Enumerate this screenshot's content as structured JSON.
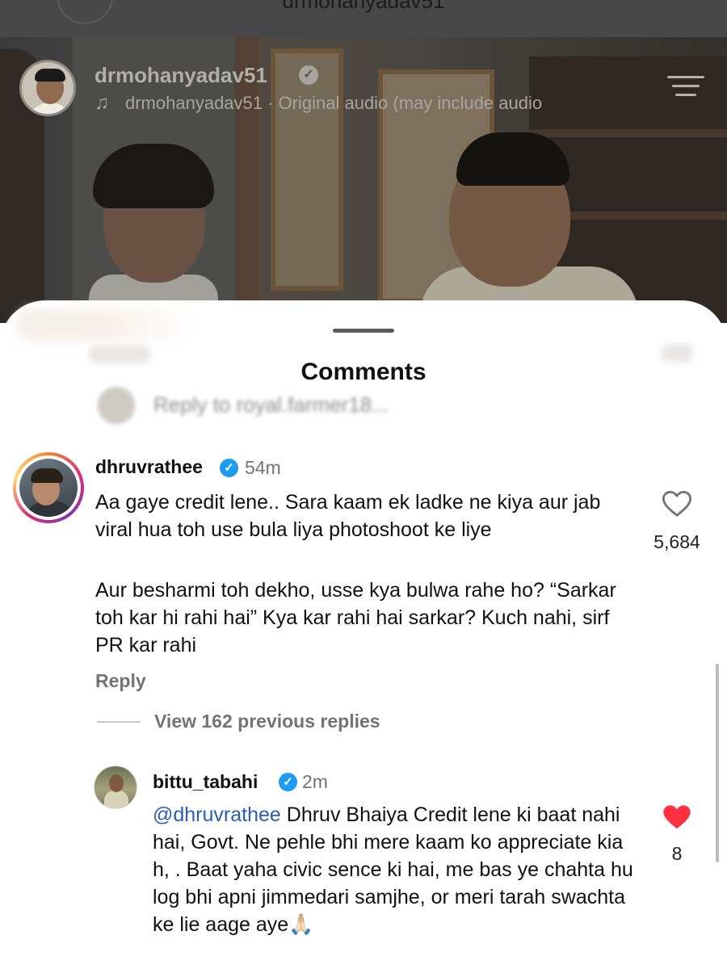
{
  "reel": {
    "top_text": "drmohanyadav51",
    "owner_username": "drmohanyadav51",
    "audio_line": "drmohanyadav51 · Original audio  (may include audio",
    "music_icon": "music-note-icon",
    "menu_icon": "menu-icon",
    "verified_glyph": "✓"
  },
  "sheet": {
    "title": "Comments",
    "reply_banner": "Reply to royal.farmer18..."
  },
  "comment": {
    "username": "dhruvrathee",
    "verified_glyph": "✓",
    "time": "54m",
    "text_para1": "Aa gaye credit lene.. Sara kaam ek ladke ne kiya aur jab viral hua toh use bula liya photoshoot ke liye",
    "text_para2": "Aur besharmi toh dekho, usse kya bulwa rahe ho? “Sarkar toh kar hi rahi hai” Kya kar rahi hai sarkar? Kuch nahi, sirf PR kar rahi",
    "likes": "5,684",
    "liked": false,
    "reply_label": "Reply",
    "view_replies": "View 162 previous replies"
  },
  "reply": {
    "username": "bittu_tabahi",
    "verified_glyph": "✓",
    "time": "2m",
    "mention": "@dhruvrathee",
    "text": " Dhruv Bhaiya Credit lene ki baat nahi hai, Govt. Ne pehle bhi mere kaam ko appreciate kia h, . Baat yaha civic sence ki hai, me bas ye chahta hu log bhi apni jimmedari samjhe, or meri tarah swachta ke lie aage aye🙏🏻",
    "likes": "8",
    "liked": true
  },
  "colors": {
    "heart_red": "#ff3040",
    "verified_blue": "#1d9bf0",
    "mention_blue": "#2b5bb8",
    "muted_text": "#737373"
  }
}
